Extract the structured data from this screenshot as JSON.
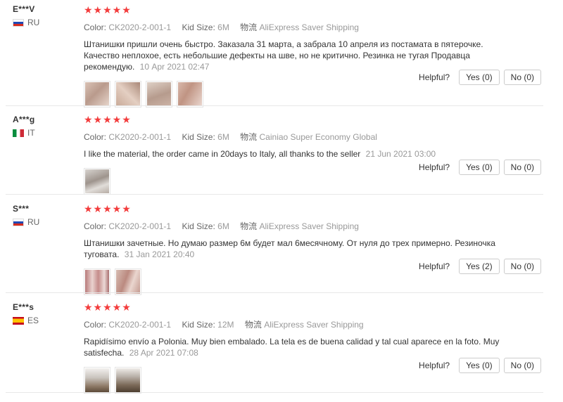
{
  "reviews": [
    {
      "user": "E***V",
      "country": "RU",
      "stars": "★★★★★",
      "color_label": "Color:",
      "color": "CK2020-2-001-1",
      "size_label": "Kid Size:",
      "size": "6M",
      "ship_label": "物流",
      "shipping": "AliExpress Saver Shipping",
      "text": "Штанишки пришли очень быстро. Заказала 31 марта, а забрала 10 апреля из постамата в пятерочке. Качество неплохое, есть небольшие дефекты на шве, но не критично. Резинка не тугая Продавца рекомендую.",
      "date": "10 Apr 2021 02:47",
      "helpful": "Helpful?",
      "yes": "Yes (0)",
      "no": "No (0)"
    },
    {
      "user": "A***g",
      "country": "IT",
      "stars": "★★★★★",
      "color_label": "Color:",
      "color": "CK2020-2-001-1",
      "size_label": "Kid Size:",
      "size": "6M",
      "ship_label": "物流",
      "shipping": "Cainiao Super Economy Global",
      "text": "I like the material, the order came in 20days to Italy, all thanks to the seller",
      "date": "21 Jun 2021 03:00",
      "helpful": "Helpful?",
      "yes": "Yes (0)",
      "no": "No (0)"
    },
    {
      "user": "S***",
      "country": "RU",
      "stars": "★★★★★",
      "color_label": "Color:",
      "color": "CK2020-2-001-1",
      "size_label": "Kid Size:",
      "size": "6M",
      "ship_label": "物流",
      "shipping": "AliExpress Saver Shipping",
      "text": "Штанишки зачетные. Но думаю размер 6м будет мал 6месячному. От нуля до трех примерно. Резиночка туговата.",
      "date": "31 Jan 2021 20:40",
      "helpful": "Helpful?",
      "yes": "Yes (2)",
      "no": "No (0)"
    },
    {
      "user": "E***s",
      "country": "ES",
      "stars": "★★★★★",
      "color_label": "Color:",
      "color": "CK2020-2-001-1",
      "size_label": "Kid Size:",
      "size": "12M",
      "ship_label": "物流",
      "shipping": "AliExpress Saver Shipping",
      "text": "Rapidísimo envío a Polonia. Muy bien embalado. La tela es de buena calidad y tal cual aparece en la foto. Muy satisfecha.",
      "date": "28 Apr 2021 07:08",
      "helpful": "Helpful?",
      "yes": "Yes (0)",
      "no": "No (0)"
    }
  ],
  "colors": {
    "star": "#f33c3c",
    "separator": "#e8e8e8",
    "meta": "#999999"
  }
}
